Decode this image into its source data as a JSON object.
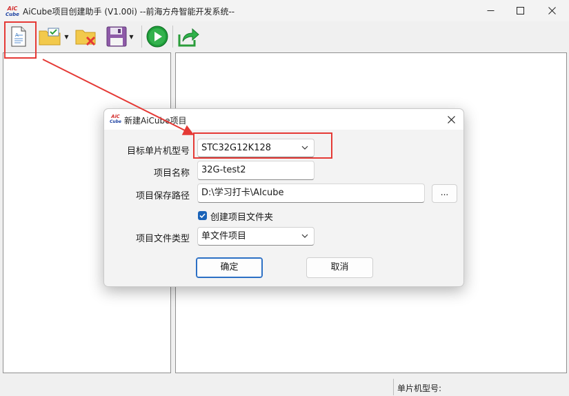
{
  "window": {
    "title": "AiCube项目创建助手 (V1.00i) --前海方舟智能开发系统--",
    "logo_text_top": "AiC",
    "logo_text_bottom": "Cube"
  },
  "toolbar": {
    "items": [
      {
        "name": "new-project-icon"
      },
      {
        "name": "open-project-icon"
      },
      {
        "name": "close-project-icon"
      },
      {
        "name": "save-icon"
      },
      {
        "name": "run-icon"
      },
      {
        "name": "export-icon"
      }
    ]
  },
  "dialog": {
    "title": "新建AiCube项目",
    "mcu_label": "目标单片机型号",
    "mcu_value": "STC32G12K128",
    "name_label": "项目名称",
    "name_value": "32G-test2",
    "path_label": "项目保存路径",
    "path_value": "D:\\学习打卡\\AIcube",
    "browse_label": "...",
    "create_folder_label": "创建项目文件夹",
    "create_folder_checked": true,
    "filetype_label": "项目文件类型",
    "filetype_value": "单文件项目",
    "ok_label": "确定",
    "cancel_label": "取消"
  },
  "statusbar": {
    "mcu_label": "单片机型号:"
  },
  "colors": {
    "annotation": "#e53935",
    "accent": "#1a63b8"
  }
}
